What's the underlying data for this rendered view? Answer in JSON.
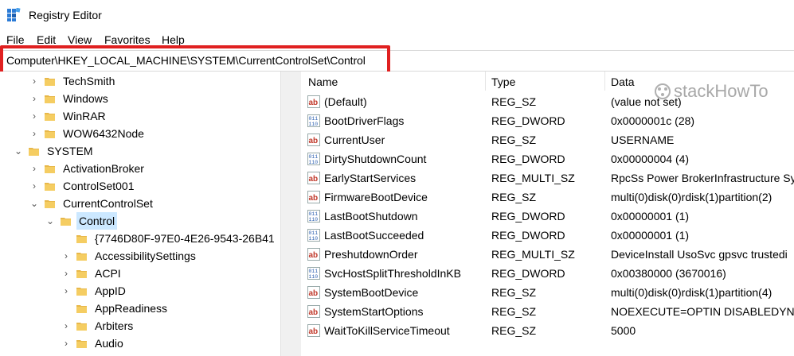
{
  "window": {
    "title": "Registry Editor"
  },
  "menu": [
    "File",
    "Edit",
    "View",
    "Favorites",
    "Help"
  ],
  "address": "Computer\\HKEY_LOCAL_MACHINE\\SYSTEM\\CurrentControlSet\\Control",
  "tree": [
    {
      "label": "TechSmith",
      "chevron": ">"
    },
    {
      "label": "Windows",
      "chevron": ">"
    },
    {
      "label": "WinRAR",
      "chevron": ">"
    },
    {
      "label": "WOW6432Node",
      "chevron": ">"
    },
    {
      "label": "SYSTEM",
      "chevron": "v"
    },
    {
      "label": "ActivationBroker",
      "chevron": ">"
    },
    {
      "label": "ControlSet001",
      "chevron": ">"
    },
    {
      "label": "CurrentControlSet",
      "chevron": "v"
    },
    {
      "label": "Control",
      "chevron": "v",
      "selected": true
    },
    {
      "label": "{7746D80F-97E0-4E26-9543-26B41",
      "chevron": ""
    },
    {
      "label": "AccessibilitySettings",
      "chevron": ">"
    },
    {
      "label": "ACPI",
      "chevron": ">"
    },
    {
      "label": "AppID",
      "chevron": ">"
    },
    {
      "label": "AppReadiness",
      "chevron": ""
    },
    {
      "label": "Arbiters",
      "chevron": ">"
    },
    {
      "label": "Audio",
      "chevron": ">"
    }
  ],
  "columns": [
    "Name",
    "Type",
    "Data"
  ],
  "values": [
    {
      "icon": "string-value-icon",
      "name": "(Default)",
      "type": "REG_SZ",
      "data": "(value not set)"
    },
    {
      "icon": "binary-value-icon",
      "name": "BootDriverFlags",
      "type": "REG_DWORD",
      "data": "0x0000001c (28)"
    },
    {
      "icon": "string-value-icon",
      "name": "CurrentUser",
      "type": "REG_SZ",
      "data": "USERNAME"
    },
    {
      "icon": "binary-value-icon",
      "name": "DirtyShutdownCount",
      "type": "REG_DWORD",
      "data": "0x00000004 (4)"
    },
    {
      "icon": "string-value-icon",
      "name": "EarlyStartServices",
      "type": "REG_MULTI_SZ",
      "data": "RpcSs Power BrokerInfrastructure Sy"
    },
    {
      "icon": "string-value-icon",
      "name": "FirmwareBootDevice",
      "type": "REG_SZ",
      "data": "multi(0)disk(0)rdisk(1)partition(2)"
    },
    {
      "icon": "binary-value-icon",
      "name": "LastBootShutdown",
      "type": "REG_DWORD",
      "data": "0x00000001 (1)"
    },
    {
      "icon": "binary-value-icon",
      "name": "LastBootSucceeded",
      "type": "REG_DWORD",
      "data": "0x00000001 (1)"
    },
    {
      "icon": "string-value-icon",
      "name": "PreshutdownOrder",
      "type": "REG_MULTI_SZ",
      "data": "DeviceInstall UsoSvc gpsvc trustedi"
    },
    {
      "icon": "binary-value-icon",
      "name": "SvcHostSplitThresholdInKB",
      "type": "REG_DWORD",
      "data": "0x00380000 (3670016)"
    },
    {
      "icon": "string-value-icon",
      "name": "SystemBootDevice",
      "type": "REG_SZ",
      "data": "multi(0)disk(0)rdisk(1)partition(4)"
    },
    {
      "icon": "string-value-icon",
      "name": "SystemStartOptions",
      "type": "REG_SZ",
      "data": " NOEXECUTE=OPTIN  DISABLEDYN"
    },
    {
      "icon": "string-value-icon",
      "name": "WaitToKillServiceTimeout",
      "type": "REG_SZ",
      "data": "5000"
    }
  ],
  "watermark": "stackHowTo",
  "colors": {
    "highlight_box": "#e02020",
    "selection": "#cce8ff",
    "folder": "#e8b84a"
  }
}
